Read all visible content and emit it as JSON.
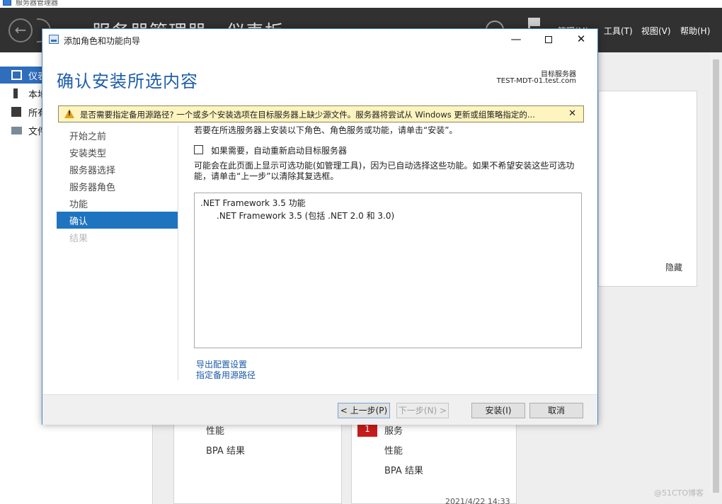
{
  "background": {
    "window_title": "服务器管理器",
    "header_title": "服务器管理器 · 仪表板",
    "header_menu": [
      "管理(M)",
      "工具(T)",
      "视图(V)",
      "帮助(H)"
    ],
    "sidebar_items": [
      "仪表板",
      "本地服务器",
      "所有服务器",
      "文件和存储服务"
    ],
    "welcome_hide": "隐藏",
    "tile_left": [
      "性能",
      "BPA 结果"
    ],
    "tile_right_badge": "1",
    "tile_right": [
      "服务",
      "性能",
      "BPA 结果"
    ],
    "timestamp": "2021/4/22 14:33",
    "watermark": "@51CTO博客"
  },
  "wizard": {
    "title": "添加角色和功能向导",
    "controls": {
      "minimize": "—",
      "close": "✕"
    },
    "heading": "确认安装所选内容",
    "target_label": "目标服务器",
    "target_server": "TEST-MDT-01.test.com",
    "warning": {
      "text": "是否需要指定备用源路径? 一个或多个安装选项在目标服务器上缺少源文件。服务器将尝试从 Windows 更新或组策略指定的...",
      "close": "✕"
    },
    "nav": [
      "开始之前",
      "安装类型",
      "服务器选择",
      "服务器角色",
      "功能",
      "确认",
      "结果"
    ],
    "instruction": "若要在所选服务器上安装以下角色、角色服务或功能，请单击“安装”。",
    "restart_checkbox_label": "如果需要，自动重新启动目标服务器",
    "note": "可能会在此页面上显示可选功能(如管理工具)，因为已自动选择这些功能。如果不希望安装这些可选功能，请单击“上一步”以清除其复选框。",
    "features": [
      ".NET Framework 3.5 功能",
      ".NET Framework 3.5 (包括 .NET 2.0 和 3.0)"
    ],
    "links": [
      "导出配置设置",
      "指定备用源路径"
    ],
    "buttons": {
      "back": "< 上一步(P)",
      "next": "下一步(N) >",
      "install": "安装(I)",
      "cancel": "取消"
    }
  }
}
